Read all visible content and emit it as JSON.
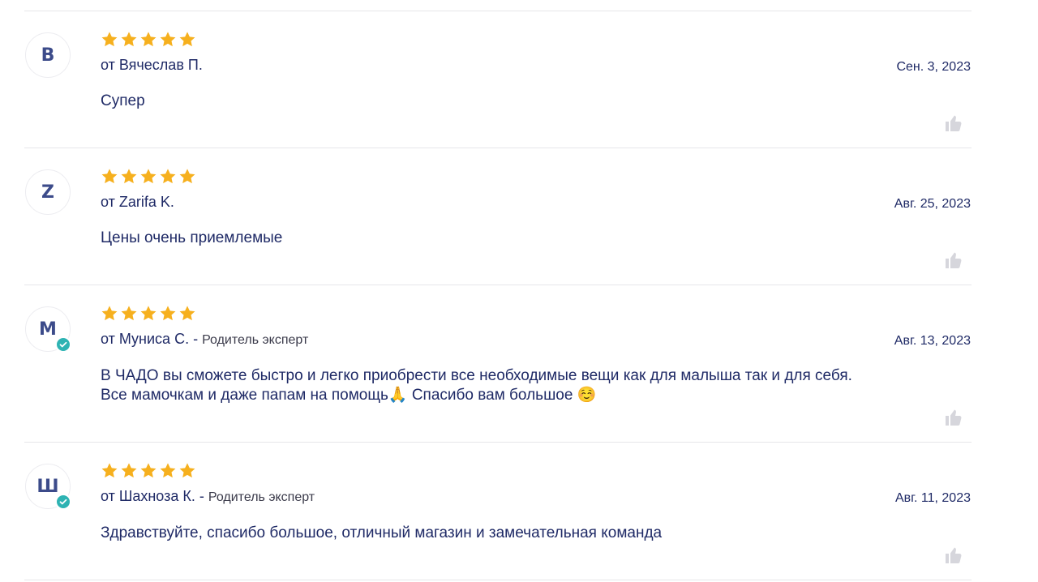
{
  "reviews": [
    {
      "initial": "В",
      "rating": 5,
      "author": "от Вячеслав П.",
      "role": "",
      "verified": false,
      "date": "Сен. 3, 2023",
      "text": "Супер"
    },
    {
      "initial": "Z",
      "rating": 5,
      "author": "от Zarifa K.",
      "role": "",
      "verified": false,
      "date": "Авг. 25, 2023",
      "text": "Цены очень приемлемые"
    },
    {
      "initial": "М",
      "rating": 5,
      "author": "от Муниса С. -",
      "role": "Родитель эксперт",
      "verified": true,
      "date": "Авг. 13, 2023",
      "text": "В ЧАДО вы сможете быстро и легко приобрести все необходимые вещи как для малыша так и для себя. Все мамочкам и даже папам на помощь🙏 Спасибо вам большое ☺️"
    },
    {
      "initial": "Ш",
      "rating": 5,
      "author": "от Шахноза К. -",
      "role": "Родитель эксперт",
      "verified": true,
      "date": "Авг. 11, 2023",
      "text": "Здравствуйте, спасибо большое, отличный магазин и замечательная команда"
    }
  ],
  "colors": {
    "star": "#f6b01e",
    "text": "#1f2a66",
    "verified": "#2eb3b3",
    "like_icon": "#d6d6dc",
    "divider": "#e6e6ea"
  },
  "icons": {
    "star": "star-icon",
    "verified": "check-icon",
    "like": "thumbs-up-icon"
  }
}
